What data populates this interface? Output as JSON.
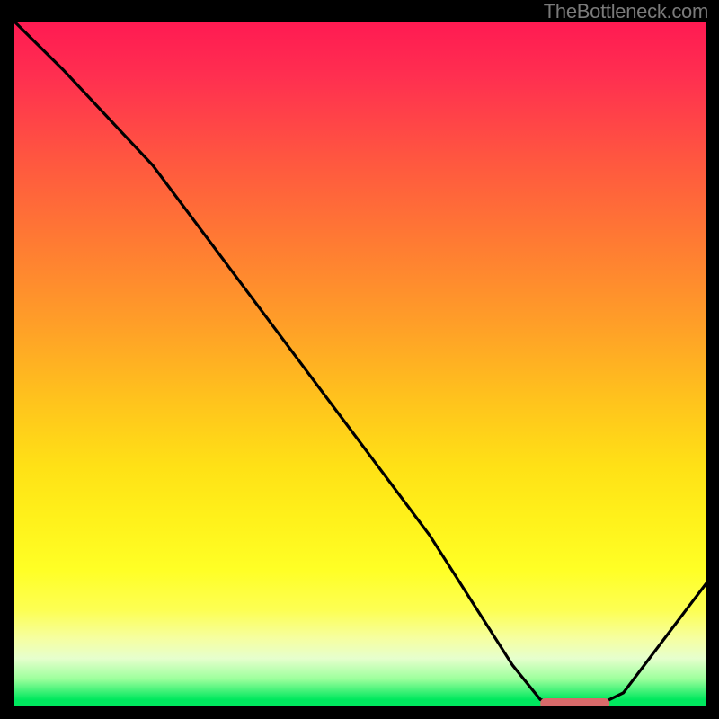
{
  "watermark": "TheBottleneck.com",
  "colors": {
    "top": "#ff1a52",
    "mid1": "#ff9e28",
    "mid2": "#ffe116",
    "bottom": "#00e85e",
    "curve": "#000000",
    "marker": "#d86a6a"
  },
  "chart_data": {
    "type": "line",
    "title": "",
    "xlabel": "",
    "ylabel": "",
    "xlim": [
      0,
      100
    ],
    "ylim": [
      0,
      100
    ],
    "series": [
      {
        "name": "curve",
        "x": [
          0,
          7,
          20,
          40,
          60,
          72,
          76,
          80,
          84,
          88,
          100
        ],
        "y": [
          100,
          93,
          79,
          52,
          25,
          6,
          1,
          0,
          0,
          2,
          18
        ]
      }
    ],
    "optimal_marker": {
      "x_start": 76,
      "x_end": 86,
      "y": 0.4
    }
  }
}
